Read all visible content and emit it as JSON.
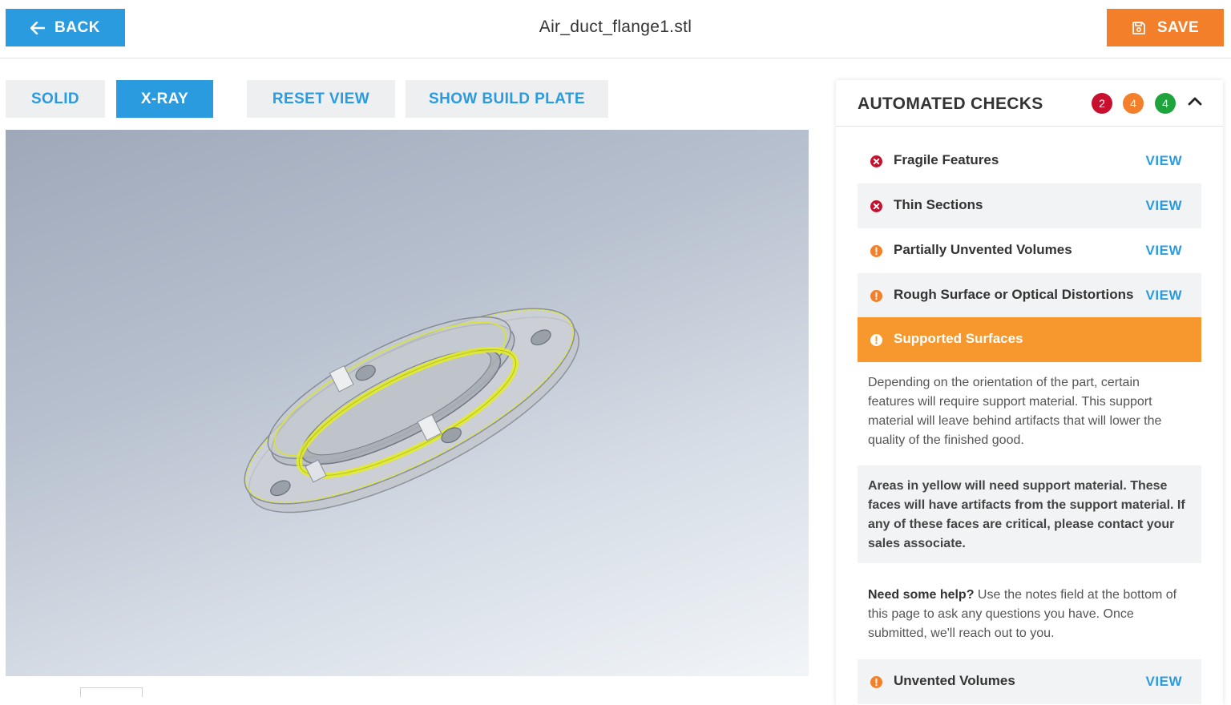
{
  "header": {
    "back_label": "BACK",
    "file_name": "Air_duct_flange1.stl",
    "save_label": "SAVE"
  },
  "toolbar": {
    "solid_label": "SOLID",
    "xray_label": "X-RAY",
    "reset_label": "RESET VIEW",
    "build_plate_label": "SHOW BUILD PLATE",
    "active_mode": "X-RAY"
  },
  "panel": {
    "title": "AUTOMATED CHECKS",
    "badges": [
      {
        "count": "2",
        "color": "#c8102e"
      },
      {
        "count": "4",
        "color": "#f37f2a"
      },
      {
        "count": "4",
        "color": "#1fa33d"
      }
    ],
    "view_label": "VIEW",
    "checks": [
      {
        "label": "Fragile Features",
        "severity": "error"
      },
      {
        "label": "Thin Sections",
        "severity": "error"
      },
      {
        "label": "Partially Unvented Volumes",
        "severity": "warning"
      },
      {
        "label": "Rough Surface or Optical Distortions",
        "severity": "warning"
      },
      {
        "label": "Supported Surfaces",
        "severity": "warning",
        "expanded": true
      },
      {
        "label": "Unvented Volumes",
        "severity": "warning"
      }
    ],
    "expanded_description": "Depending on the orientation of the part, certain features will require support material. This support material will leave behind artifacts that will lower the quality of the finished good.",
    "expanded_note": "Areas in yellow will need support material. These faces will have artifacts from the support material. If any of these faces are critical, please contact your sales associate.",
    "help_bold": "Need some help?",
    "help_text": " Use the notes field at the bottom of this page to ask any questions you have. Once submitted, we'll reach out to you."
  },
  "colors": {
    "primary_blue": "#2b9be0",
    "save_orange": "#f37f2a",
    "highlight_orange": "#f7982f",
    "error_red": "#c8102e",
    "warning_orange": "#f37f2a",
    "success_green": "#1fa33d",
    "support_yellow": "#e6f000"
  }
}
